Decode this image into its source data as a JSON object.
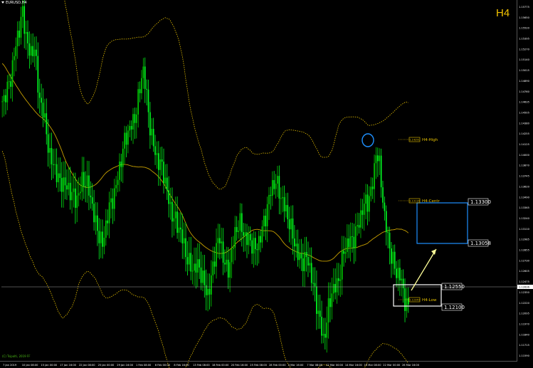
{
  "chart": {
    "symbol": "EURUSD,H4",
    "timeframe": "H4",
    "watermark": "(C) Tsipolti, 2019 FF",
    "price_scale": {
      "min": 1.1181,
      "max": 1.1584
    }
  },
  "colors": {
    "background": "#000000",
    "candle_up": "#00d000",
    "candle_down": "#00ff22",
    "outer_band": "#e6c000",
    "middle_band": "#c8a000",
    "grid_label": "#ffffff",
    "timeframe": "#f2c200",
    "level_tag": "#e6c000",
    "resistance_box": "#1e90ff",
    "support_box": "#ffffff",
    "current_price_line": "#a0a0a0",
    "circle": "#1e90ff",
    "arrow": "#ffff99"
  },
  "y_axis": {
    "ticks": [
      "1.15775",
      "1.15650",
      "1.15520",
      "1.15395",
      "1.15270",
      "1.15140",
      "1.15015",
      "1.14890",
      "1.14760",
      "1.14635",
      "1.14505",
      "1.14380",
      "1.14255",
      "1.14125",
      "1.14000",
      "1.13870",
      "1.13745",
      "1.13620",
      "1.13490",
      "1.13365",
      "1.13240",
      "1.13110",
      "1.12985",
      "1.12855",
      "1.12730",
      "1.12605",
      "1.12475",
      "1.12350",
      "1.12220",
      "1.12095",
      "1.11970",
      "1.11840",
      "1.11715",
      "1.11590"
    ],
    "current_price": "1.12636"
  },
  "x_axis": {
    "ticks": [
      "7 Jan 2019",
      "10 Jan 08:00",
      "15 Jan 00:00",
      "17 Jan 16:00",
      "22 Jan 08:00",
      "25 Jan 00:00",
      "29 Jan 16:00",
      "1 Feb 08:00",
      "6 Feb 00:00",
      "8 Feb 16:00",
      "13 Feb 08:00",
      "18 Feb 00:00",
      "20 Feb 16:00",
      "25 Feb 08:00",
      "28 Feb 00:00",
      "4 Mar 16:00",
      "7 Mar 08:00",
      "12 Mar 00:00",
      "14 Mar 16:00",
      "19 Mar 08:00",
      "22 Mar 00:00",
      "26 Mar 16:00"
    ]
  },
  "levels": [
    {
      "name": "H4-High",
      "tag": "1.14291"
    },
    {
      "name": "H4-Centr",
      "tag": "1.13116"
    },
    {
      "name": "H4-Low",
      "tag": "1.12340"
    }
  ],
  "zones": {
    "resistance": {
      "top_label": "1.13300",
      "bottom_label": "1.13058"
    },
    "support": {
      "top_label": "1.12550",
      "bottom_label": "1.12100"
    }
  },
  "chart_data": {
    "type": "candlestick",
    "symbol": "EURUSD",
    "timeframe": "H4",
    "price_range": [
      1.1181,
      1.1584
    ],
    "series": [
      {
        "close": [
          1.1472,
          1.1488,
          1.1498,
          1.152,
          1.1545,
          1.1575,
          1.155,
          1.152,
          1.153,
          1.148,
          1.147,
          1.144,
          1.14,
          1.1395,
          1.1385,
          1.1388,
          1.1375,
          1.1365,
          1.136,
          1.1372,
          1.139,
          1.1375,
          1.136,
          1.134,
          1.133,
          1.131,
          1.1335,
          1.1355,
          1.1375,
          1.1398,
          1.1415,
          1.143,
          1.1445,
          1.146,
          1.148,
          1.1505,
          1.147,
          1.144,
          1.142,
          1.14,
          1.139,
          1.137,
          1.1355,
          1.134,
          1.1325,
          1.131,
          1.13,
          1.129,
          1.1285,
          1.128,
          1.127,
          1.126,
          1.1275,
          1.13,
          1.1315,
          1.13,
          1.1285,
          1.13,
          1.132,
          1.1335,
          1.133,
          1.132,
          1.131,
          1.13,
          1.132,
          1.134,
          1.1355,
          1.137,
          1.138,
          1.1375,
          1.136,
          1.134,
          1.132,
          1.131,
          1.13,
          1.1295,
          1.129,
          1.127,
          1.1255,
          1.123,
          1.12,
          1.123,
          1.126,
          1.127,
          1.128,
          1.13,
          1.131,
          1.132,
          1.133,
          1.134,
          1.135,
          1.136,
          1.138,
          1.142,
          1.139,
          1.134,
          1.132,
          1.13,
          1.128,
          1.127,
          1.125,
          1.1245
        ]
      },
      {
        "name": "H4-High"
      },
      {
        "name": "H4-Centr"
      },
      {
        "name": "H4-Low"
      }
    ]
  }
}
